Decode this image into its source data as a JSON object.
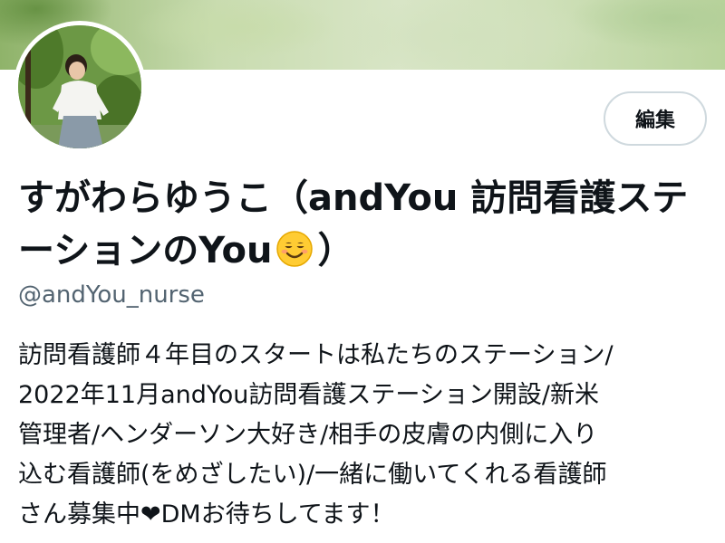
{
  "profile": {
    "display_name_part1": "すがわらゆうこ（andYou 訪問看護ステーションのYou",
    "display_name_part2": "）",
    "display_name_emoji": "smiling-face-emoji",
    "handle": "@andYou_nurse",
    "edit_button_label": "編集",
    "bio_lines": [
      "訪問看護師４年目のスタートは私たちのステーション/",
      "2022年11月andYou訪問看護ステーション開設/新米",
      "管理者/ヘンダーソン大好き/相手の皮膚の内側に入り",
      "込む看護師(をめざしたい)/一緒に働いてくれる看護師"
    ],
    "bio_last_prefix": "さん募集中",
    "bio_last_heart": "❤",
    "bio_last_suffix": "DMお待ちしてます！"
  },
  "icons": {
    "avatar": "profile-photo",
    "heart": "heart-icon"
  },
  "colors": {
    "text_primary": "#0f1419",
    "text_secondary": "#536471",
    "button_border": "#cfd9de",
    "banner_green": "#b9d39c"
  }
}
